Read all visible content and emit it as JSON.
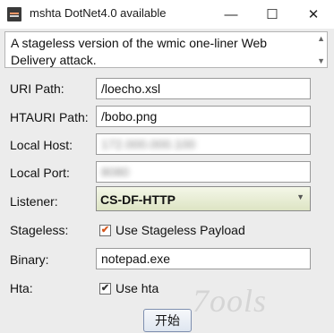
{
  "window": {
    "title": "mshta DotNet4.0 available",
    "minimize_glyph": "—",
    "maximize_glyph": "☐",
    "close_glyph": "✕"
  },
  "description": {
    "text": "A stageless version of the wmic one-liner Web Delivery attack."
  },
  "form": {
    "uri_path": {
      "label": "URI Path:",
      "value": "/loecho.xsl"
    },
    "htauri_path": {
      "label": "HTAURI Path:",
      "value": "/bobo.png"
    },
    "local_host": {
      "label": "Local Host:",
      "value": "172.000.000.100"
    },
    "local_port": {
      "label": "Local Port:",
      "value": "8080"
    },
    "listener": {
      "label": "Listener:",
      "value": "CS-DF-HTTP"
    },
    "stageless": {
      "label": "Stageless:",
      "checkbox_label": "Use Stageless Payload",
      "checked": true,
      "check_color": "#d4561c"
    },
    "binary": {
      "label": "Binary:",
      "value": "notepad.exe"
    },
    "hta": {
      "label": "Hta:",
      "checkbox_label": "Use hta",
      "checked": true
    }
  },
  "buttons": {
    "start_label": "开始"
  },
  "watermark": {
    "text": "7ools"
  }
}
